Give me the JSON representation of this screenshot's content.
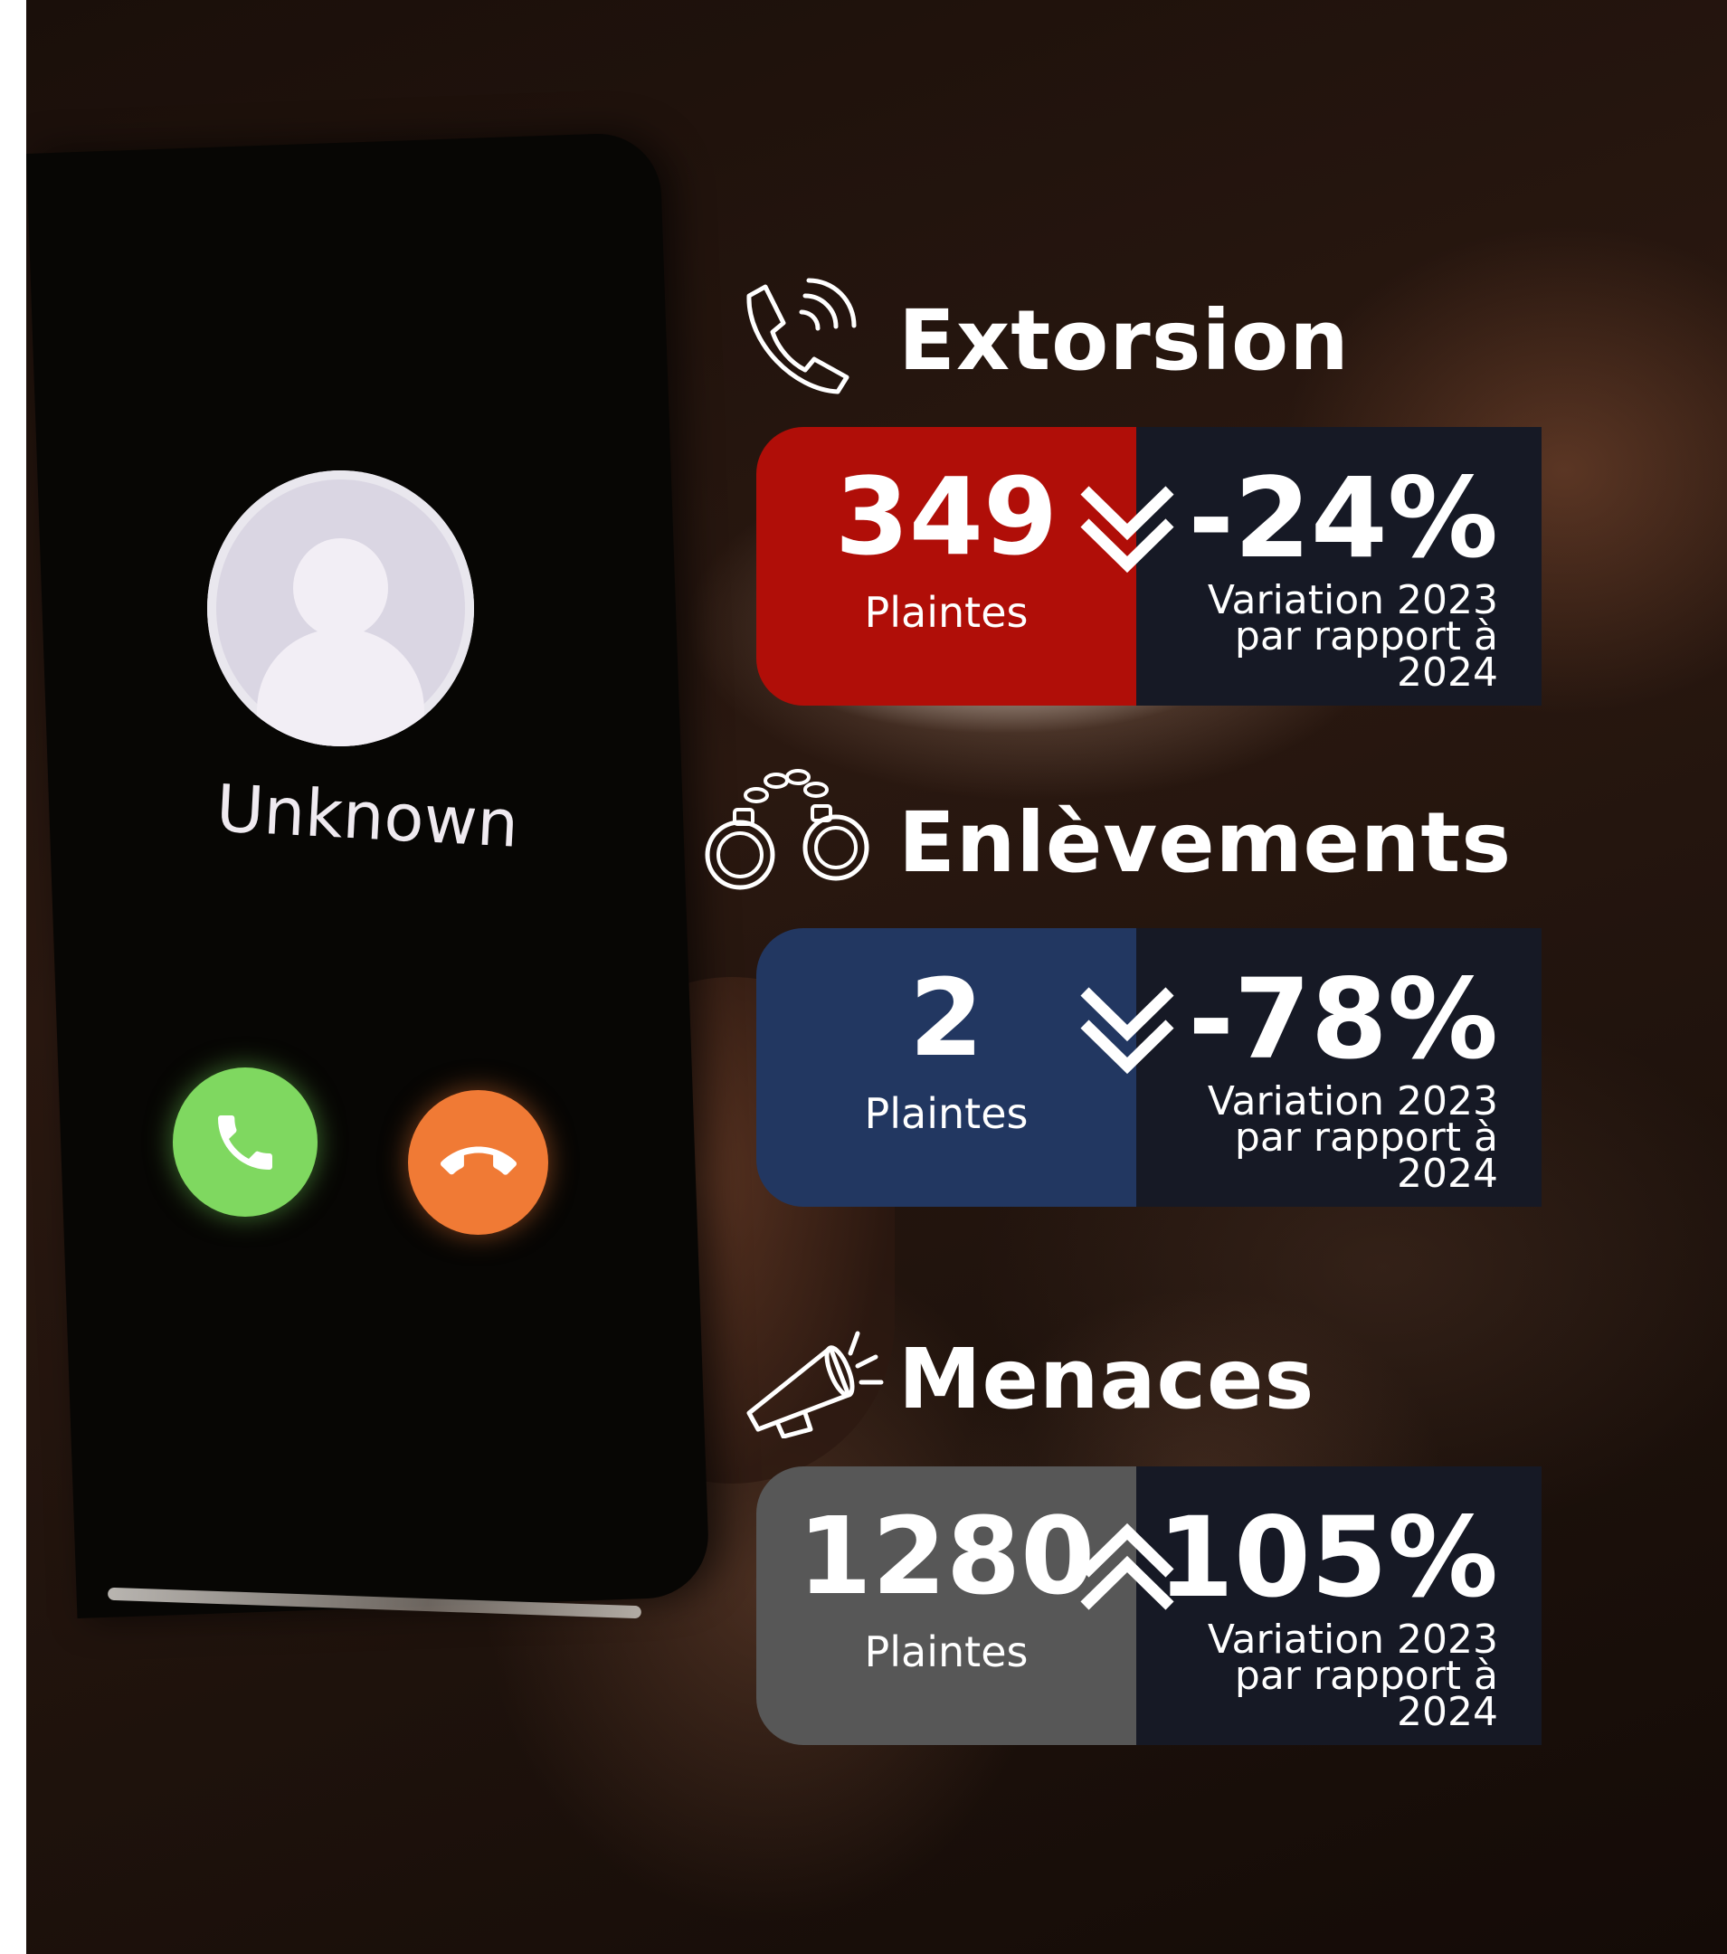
{
  "phone": {
    "caller_name": "Unknown"
  },
  "colors": {
    "extorsion": "#b00e08",
    "enlevements": "#223761",
    "menaces": "#575757",
    "dark_panel": "#161925"
  },
  "stats": [
    {
      "title": "Extorsion",
      "icon": "phone-ringing-icon",
      "count": "349",
      "count_label": "Plaintes",
      "trend": "down",
      "variation": "-24%",
      "variation_label": "Variation 2023 par rapport à 2024"
    },
    {
      "title": "Enlèvements",
      "icon": "handcuffs-icon",
      "count": "2",
      "count_label": "Plaintes",
      "trend": "down",
      "variation": "-78%",
      "variation_label": "Variation 2023 par rapport à 2024"
    },
    {
      "title": "Menaces",
      "icon": "megaphone-icon",
      "count": "1280",
      "count_label": "Plaintes",
      "trend": "up",
      "variation": "105%",
      "variation_label": "Variation 2023 par rapport à 2024"
    }
  ]
}
